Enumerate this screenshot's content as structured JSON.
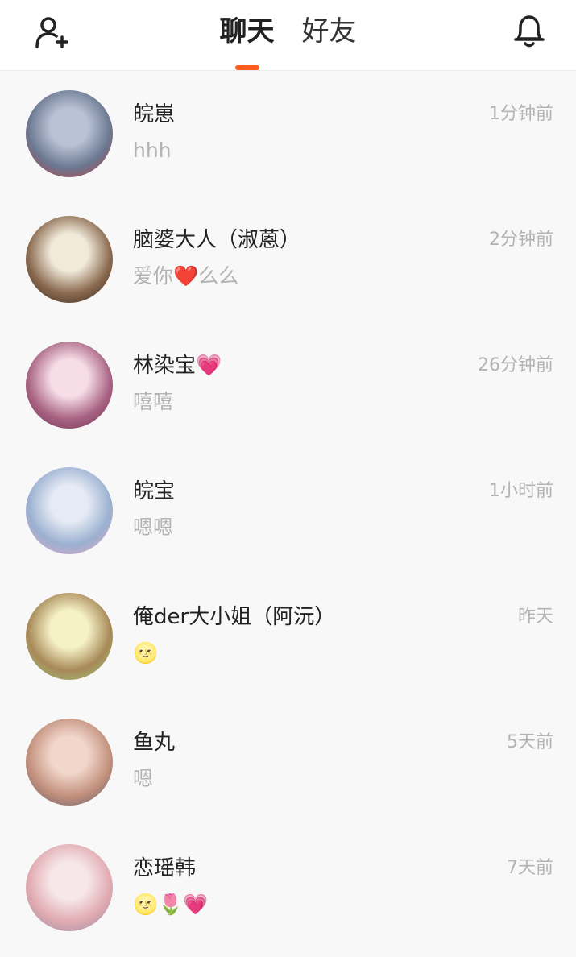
{
  "header": {
    "tabs": [
      {
        "label": "聊天",
        "active": true
      },
      {
        "label": "好友",
        "active": false
      }
    ],
    "accent_color": "#ff5a1f"
  },
  "chats": [
    {
      "name": "皖崽",
      "preview": "hhh",
      "time": "1分钟前",
      "avatar_colors": [
        "#b9c3d6",
        "#6a7790",
        "#c9363a"
      ]
    },
    {
      "name": "脑婆大人（淑蒽）",
      "preview": "爱你❤️么么",
      "time": "2分钟前",
      "avatar_colors": [
        "#f1eadb",
        "#8a6a4f",
        "#2b1d18"
      ]
    },
    {
      "name": "林染宝💗",
      "preview": "嘻嘻",
      "time": "26分钟前",
      "avatar_colors": [
        "#f6dde6",
        "#a86383",
        "#6b2a4c"
      ]
    },
    {
      "name": "皖宝",
      "preview": "嗯嗯",
      "time": "1小时前",
      "avatar_colors": [
        "#e5eaf4",
        "#9ab0d0",
        "#f3a6c4"
      ]
    },
    {
      "name": "俺der大小姐（阿沅）",
      "preview": "🌝",
      "time": "昨天",
      "avatar_colors": [
        "#f6f2c8",
        "#a78957",
        "#9fcf82"
      ]
    },
    {
      "name": "鱼丸",
      "preview": "嗯",
      "time": "5天前",
      "avatar_colors": [
        "#f1d6cb",
        "#c2907c",
        "#5b5568"
      ]
    },
    {
      "name": "恋瑶韩",
      "preview": "🌝🌷💗",
      "time": "7天前",
      "avatar_colors": [
        "#f7e7ea",
        "#e0aab0",
        "#8c8aa4"
      ]
    }
  ]
}
